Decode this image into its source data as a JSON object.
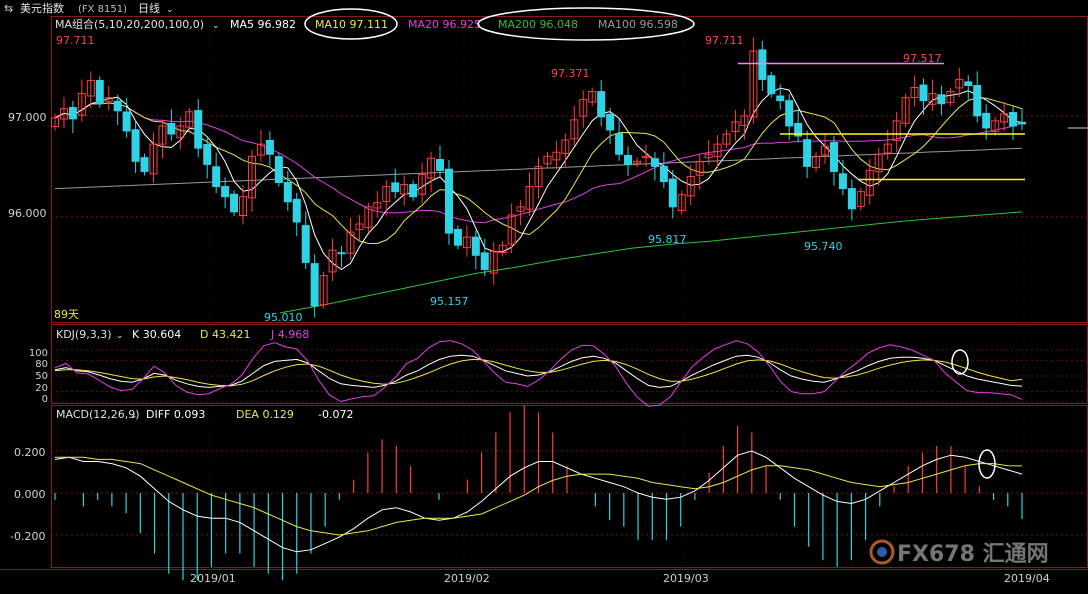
{
  "header": {
    "instrument": "美元指数",
    "code": "(FX 8151)",
    "period": "日线"
  },
  "colors": {
    "up": "#ff3b3b",
    "down": "#2fd3e6",
    "ma5": "#ffffff",
    "ma10": "#e8e84a",
    "ma20": "#e040e0",
    "ma200": "#30c030",
    "ma100": "#9a9a9a",
    "hline_pink": "#ff80ff",
    "hline_yellow": "#ffff00",
    "circle": "#ffffff",
    "kdj_k": "#ffffff",
    "kdj_d": "#e8e84a",
    "kdj_j": "#e040e0",
    "macd_diff": "#ffffff",
    "macd_dea": "#e8e84a"
  },
  "main": {
    "legend": {
      "title": "MA组合(5,10,20,200,100,0)",
      "ma5": "MA5 96.982",
      "ma10": "MA10 97.111",
      "ma20": "MA20 96.925",
      "ma200": "MA200 96.048",
      "ma100": "MA100 96.598"
    },
    "top_label": "97.711",
    "y_ticks": [
      "97.000",
      "96.000"
    ],
    "annotations": {
      "peak_high": "97.711",
      "feb_high": "97.371",
      "mar_high": "97.517",
      "jan_low": "95.010",
      "feb_low": "95.157",
      "feb_low2": "95.817",
      "mar_low": "95.740"
    },
    "days_label": "89天"
  },
  "kdj": {
    "title": "KDJ(9,3,3)",
    "k": "K 30.604",
    "d": "D 43.421",
    "j": "J 4.968",
    "y_ticks": [
      "100",
      "80",
      "50",
      "20",
      "0"
    ]
  },
  "macd": {
    "title": "MACD(12,26,9)",
    "diff": "DIFF 0.093",
    "dea": "DEA 0.129",
    "macd": "-0.072",
    "y_ticks": [
      "0.200",
      "0.000",
      "-0.200"
    ]
  },
  "x_ticks": [
    "2019/01",
    "2019/02",
    "2019/03",
    "2019/04"
  ],
  "watermark": "FX678 汇通网",
  "chart_data": [
    {
      "type": "candlestick",
      "title": "美元指数(FX 8151) 日线",
      "x_ticks": [
        "2019/01",
        "2019/02",
        "2019/03",
        "2019/04"
      ],
      "ylim": [
        95.0,
        97.75
      ],
      "y_ticks": [
        97.0,
        96.0
      ],
      "grid": true,
      "price_path": [
        96.98,
        97.07,
        96.97,
        97.22,
        97.35,
        97.12,
        97.18,
        97.05,
        96.85,
        96.55,
        96.45,
        96.72,
        96.9,
        96.82,
        96.9,
        97.04,
        96.68,
        96.52,
        96.3,
        96.2,
        96.05,
        96.2,
        96.6,
        96.72,
        96.62,
        96.34,
        96.15,
        95.95,
        95.55,
        95.12,
        95.42,
        95.67,
        95.64,
        95.85,
        95.93,
        96.1,
        96.14,
        96.3,
        96.25,
        96.32,
        96.2,
        96.42,
        96.58,
        96.46,
        95.84,
        95.72,
        95.8,
        95.62,
        95.48,
        95.66,
        95.72,
        96.02,
        96.1,
        96.3,
        96.5,
        96.6,
        96.64,
        96.76,
        96.96,
        97.16,
        97.24,
        96.99,
        96.86,
        96.62,
        96.52,
        96.55,
        96.6,
        96.5,
        96.35,
        96.1,
        96.22,
        96.4,
        96.55,
        96.62,
        96.72,
        96.82,
        96.94,
        97.0,
        97.64,
        97.36,
        97.22,
        97.15,
        96.9,
        96.8,
        96.5,
        96.6,
        96.7,
        96.45,
        96.28,
        96.08,
        96.25,
        96.46,
        96.62,
        96.72,
        96.95,
        97.18,
        97.28,
        97.15,
        97.22,
        97.12,
        97.24,
        97.36,
        97.3,
        97.0,
        96.88,
        96.95,
        97.02,
        96.9,
        96.92
      ],
      "series": [
        {
          "name": "MA5",
          "value": 96.982
        },
        {
          "name": "MA10",
          "value": 97.111
        },
        {
          "name": "MA20",
          "value": 96.925
        },
        {
          "name": "MA200",
          "value": 96.048,
          "path": [
            95.05,
            95.12,
            95.2,
            95.28,
            95.36,
            95.44,
            95.5,
            95.57,
            95.63,
            95.69,
            95.73,
            95.76,
            95.8,
            95.84,
            95.88,
            95.92,
            95.96,
            95.99,
            96.02,
            96.05
          ]
        },
        {
          "name": "MA100",
          "value": 96.598
        }
      ],
      "annotations": [
        {
          "label": "97.711",
          "kind": "high"
        },
        {
          "label": "97.371",
          "kind": "high"
        },
        {
          "label": "97.517",
          "kind": "high"
        },
        {
          "label": "95.010",
          "kind": "low"
        },
        {
          "label": "95.157",
          "kind": "low"
        },
        {
          "label": "95.817",
          "kind": "low"
        },
        {
          "label": "95.740",
          "kind": "low"
        }
      ]
    },
    {
      "type": "line",
      "title": "KDJ(9,3,3)",
      "ylim": [
        0,
        100
      ],
      "y_ticks": [
        100,
        80,
        50,
        20,
        0
      ],
      "series": [
        {
          "name": "K",
          "last": 30.604,
          "values": [
            62,
            66,
            60,
            58,
            52,
            45,
            40,
            38,
            44,
            55,
            52,
            42,
            35,
            30,
            28,
            30,
            32,
            40,
            55,
            70,
            78,
            80,
            82,
            75,
            60,
            45,
            35,
            32,
            30,
            28,
            32,
            40,
            52,
            60,
            72,
            82,
            88,
            90,
            88,
            80,
            70,
            60,
            55,
            50,
            52,
            58,
            68,
            78,
            85,
            88,
            84,
            75,
            60,
            45,
            32,
            28,
            30,
            40,
            52,
            62,
            72,
            80,
            88,
            90,
            86,
            76,
            62,
            50,
            44,
            40,
            38,
            44,
            52,
            60,
            70,
            78,
            84,
            86,
            86,
            84,
            80,
            70,
            60,
            50,
            44,
            40,
            36,
            32,
            30.6
          ]
        },
        {
          "name": "D",
          "last": 43.421,
          "values": [
            60,
            62,
            62,
            60,
            57,
            53,
            49,
            45,
            44,
            48,
            50,
            47,
            43,
            38,
            34,
            32,
            31,
            34,
            41,
            51,
            60,
            67,
            72,
            73,
            69,
            61,
            52,
            45,
            40,
            36,
            34,
            36,
            41,
            48,
            56,
            65,
            73,
            79,
            82,
            81,
            77,
            71,
            65,
            60,
            57,
            57,
            61,
            67,
            73,
            78,
            80,
            78,
            72,
            63,
            53,
            45,
            40,
            40,
            44,
            50,
            57,
            65,
            73,
            79,
            81,
            79,
            73,
            65,
            58,
            52,
            47,
            46,
            48,
            52,
            58,
            65,
            71,
            76,
            79,
            81,
            80,
            77,
            71,
            64,
            57,
            51,
            46,
            41,
            43.4
          ]
        },
        {
          "name": "J",
          "last": 4.968,
          "values": [
            66,
            74,
            56,
            54,
            42,
            29,
            22,
            24,
            44,
            69,
            56,
            32,
            19,
            14,
            16,
            26,
            34,
            52,
            83,
            108,
            114,
            106,
            102,
            79,
            42,
            13,
            1,
            6,
            10,
            12,
            28,
            48,
            74,
            84,
            104,
            116,
            118,
            112,
            100,
            78,
            56,
            38,
            35,
            30,
            42,
            60,
            82,
            100,
            109,
            108,
            92,
            69,
            36,
            9,
            -10,
            -6,
            10,
            40,
            68,
            86,
            102,
            110,
            118,
            112,
            96,
            70,
            40,
            20,
            16,
            16,
            20,
            40,
            60,
            76,
            94,
            104,
            110,
            106,
            100,
            90,
            80,
            56,
            38,
            22,
            18,
            18,
            16,
            14,
            5.0
          ]
        }
      ]
    },
    {
      "type": "line",
      "title": "MACD(12,26,9)",
      "ylim": [
        -0.32,
        0.3
      ],
      "y_ticks": [
        0.2,
        0.0,
        -0.2
      ],
      "series": [
        {
          "name": "DIFF",
          "last": 0.093,
          "values": [
            0.16,
            0.17,
            0.15,
            0.15,
            0.14,
            0.12,
            0.08,
            0.02,
            -0.04,
            -0.08,
            -0.11,
            -0.12,
            -0.12,
            -0.14,
            -0.18,
            -0.22,
            -0.26,
            -0.28,
            -0.27,
            -0.24,
            -0.21,
            -0.17,
            -0.12,
            -0.08,
            -0.07,
            -0.09,
            -0.12,
            -0.13,
            -0.12,
            -0.09,
            -0.04,
            0.02,
            0.08,
            0.12,
            0.15,
            0.15,
            0.12,
            0.09,
            0.07,
            0.05,
            0.03,
            0.0,
            -0.02,
            -0.03,
            -0.02,
            0.01,
            0.06,
            0.12,
            0.18,
            0.2,
            0.17,
            0.12,
            0.07,
            0.03,
            -0.01,
            -0.04,
            -0.05,
            -0.03,
            0.01,
            0.05,
            0.09,
            0.13,
            0.16,
            0.18,
            0.17,
            0.15,
            0.13,
            0.11,
            0.09
          ]
        },
        {
          "name": "DEA",
          "last": 0.129,
          "values": [
            0.17,
            0.17,
            0.17,
            0.16,
            0.16,
            0.15,
            0.14,
            0.11,
            0.08,
            0.05,
            0.02,
            -0.01,
            -0.03,
            -0.05,
            -0.07,
            -0.1,
            -0.13,
            -0.16,
            -0.18,
            -0.19,
            -0.2,
            -0.19,
            -0.18,
            -0.16,
            -0.14,
            -0.13,
            -0.12,
            -0.12,
            -0.12,
            -0.11,
            -0.1,
            -0.07,
            -0.04,
            -0.01,
            0.03,
            0.06,
            0.08,
            0.09,
            0.09,
            0.09,
            0.08,
            0.07,
            0.05,
            0.04,
            0.03,
            0.02,
            0.03,
            0.05,
            0.08,
            0.11,
            0.13,
            0.13,
            0.12,
            0.11,
            0.09,
            0.07,
            0.05,
            0.04,
            0.03,
            0.04,
            0.05,
            0.07,
            0.09,
            0.11,
            0.13,
            0.14,
            0.14,
            0.13,
            0.129
          ]
        },
        {
          "name": "MACD",
          "last": -0.072
        }
      ]
    }
  ]
}
